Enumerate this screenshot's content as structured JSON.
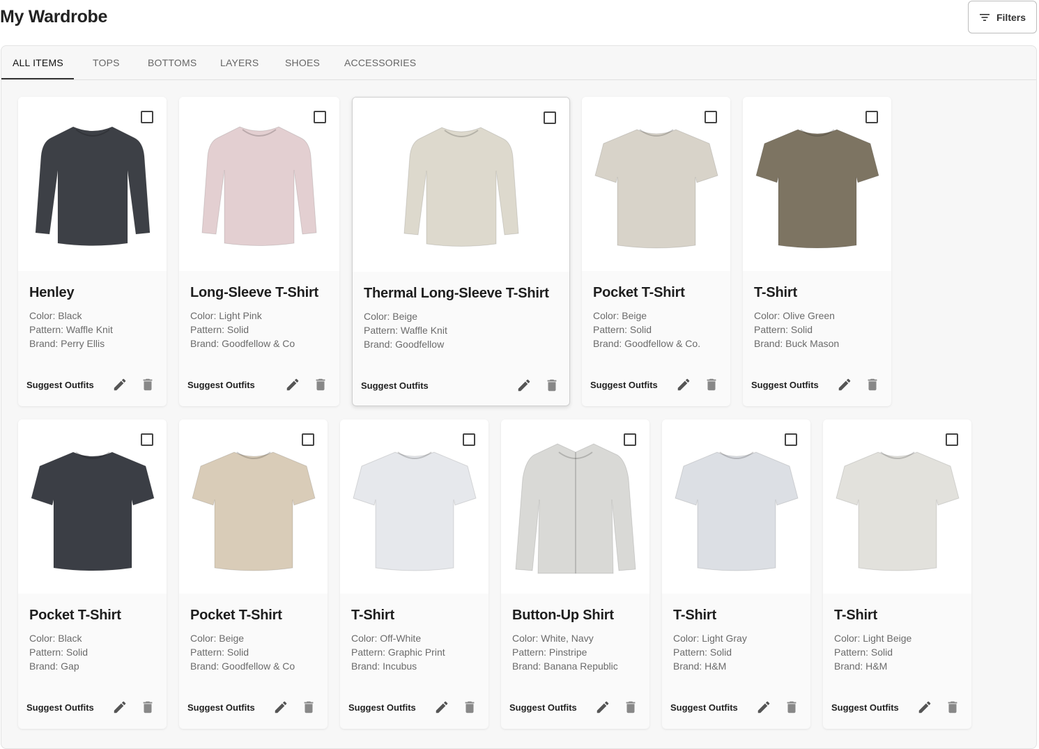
{
  "header": {
    "title": "My Wardrobe",
    "filters_label": "Filters"
  },
  "tabs": [
    {
      "label": "ALL ITEMS",
      "active": true
    },
    {
      "label": "TOPS",
      "active": false
    },
    {
      "label": "BOTTOMS",
      "active": false
    },
    {
      "label": "LAYERS",
      "active": false
    },
    {
      "label": "SHOES",
      "active": false
    },
    {
      "label": "ACCESSORIES",
      "active": false
    }
  ],
  "actions": {
    "suggest_label": "Suggest Outfits"
  },
  "colors": {
    "accent": "#333333",
    "icon": "#555555"
  },
  "items": [
    {
      "name": "Henley",
      "color": "Color: Black",
      "pattern": "Pattern: Waffle Knit",
      "brand": "Brand: Perry Ellis",
      "garment": "long-sleeve",
      "fill": "#3d4046"
    },
    {
      "name": "Long-Sleeve T-Shirt",
      "color": "Color: Light Pink",
      "pattern": "Pattern: Solid",
      "brand": "Brand: Goodfellow & Co",
      "garment": "long-sleeve",
      "fill": "#e3cfd1"
    },
    {
      "name": "Thermal Long-Sleeve T-Shirt",
      "color": "Color: Beige",
      "pattern": "Pattern: Waffle Knit",
      "brand": "Brand: Goodfellow",
      "garment": "long-sleeve",
      "fill": "#ddd9cd"
    },
    {
      "name": "Pocket T-Shirt",
      "color": "Color: Beige",
      "pattern": "Pattern: Solid",
      "brand": "Brand: Goodfellow & Co.",
      "garment": "tshirt",
      "fill": "#d8d3c9"
    },
    {
      "name": "T-Shirt",
      "color": "Color: Olive Green",
      "pattern": "Pattern: Solid",
      "brand": "Brand: Buck Mason",
      "garment": "tshirt",
      "fill": "#7d7462"
    },
    {
      "name": "Pocket T-Shirt",
      "color": "Color: Black",
      "pattern": "Pattern: Solid",
      "brand": "Brand: Gap",
      "garment": "tshirt",
      "fill": "#3b3e45"
    },
    {
      "name": "Pocket T-Shirt",
      "color": "Color: Beige",
      "pattern": "Pattern: Solid",
      "brand": "Brand: Goodfellow & Co",
      "garment": "tshirt",
      "fill": "#d9ccb8"
    },
    {
      "name": "T-Shirt",
      "color": "Color: Off-White",
      "pattern": "Pattern: Graphic Print",
      "brand": "Brand: Incubus",
      "garment": "tshirt",
      "fill": "#e6e8ec"
    },
    {
      "name": "Button-Up Shirt",
      "color": "Color: White, Navy",
      "pattern": "Pattern: Pinstripe",
      "brand": "Brand: Banana Republic",
      "garment": "button-up",
      "fill": "#d9d9d6"
    },
    {
      "name": "T-Shirt",
      "color": "Color: Light Gray",
      "pattern": "Pattern: Solid",
      "brand": "Brand: H&M",
      "garment": "tshirt",
      "fill": "#dcdfe4"
    },
    {
      "name": "T-Shirt",
      "color": "Color: Light Beige",
      "pattern": "Pattern: Solid",
      "brand": "Brand: H&M",
      "garment": "tshirt",
      "fill": "#e2e1dc"
    }
  ]
}
